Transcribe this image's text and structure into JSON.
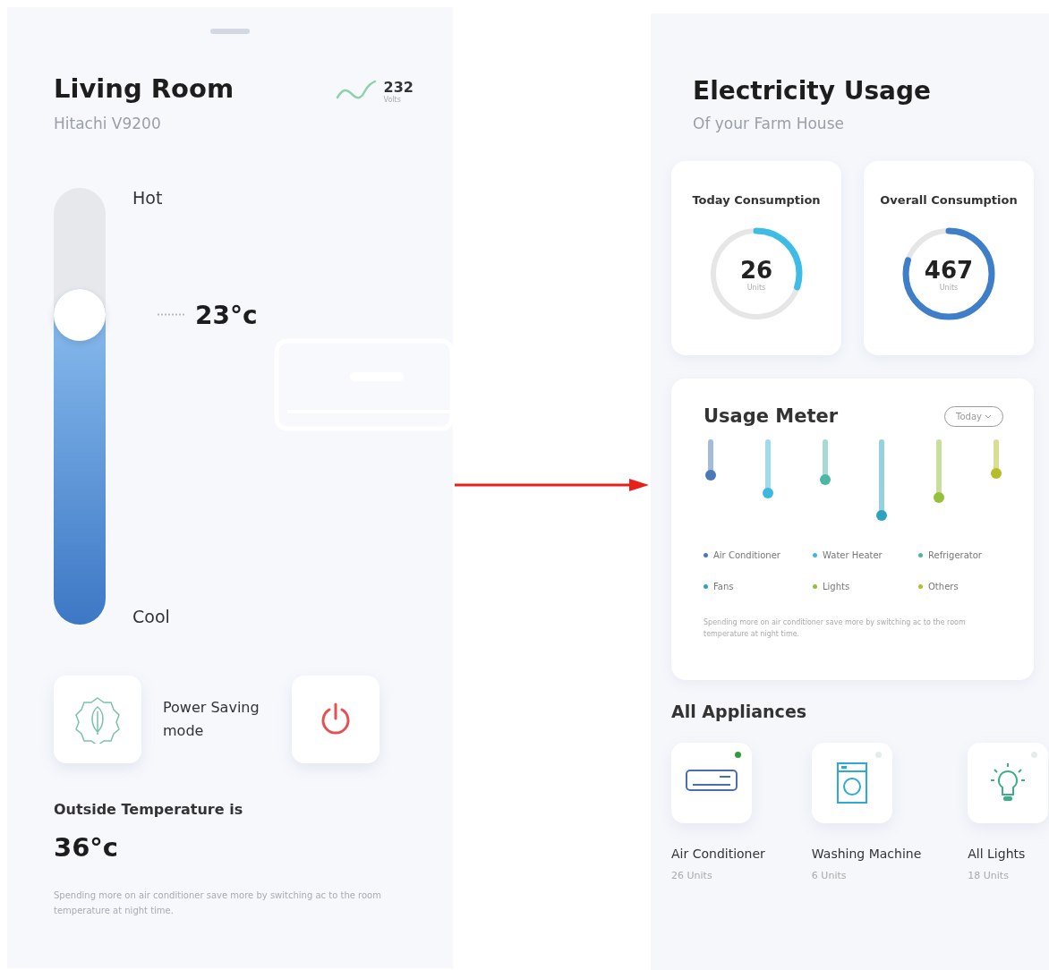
{
  "room": {
    "title": "Living Room",
    "subtitle": "Hitachi V9200",
    "voltage": "232",
    "voltage_unit": "Volts"
  },
  "thermostat": {
    "hot_label": "Hot",
    "cool_label": "Cool",
    "reading": "23°c"
  },
  "power_saving": {
    "label": "Power Saving mode"
  },
  "outside": {
    "label": "Outside Temperature is",
    "value": "36°c",
    "tip": "Spending more on air conditioner save more by switching ac to the room temperature at night time."
  },
  "usage": {
    "title": "Electricity Usage",
    "subtitle": "Of your Farm House",
    "consumption": [
      {
        "label": "Today Consumption",
        "value": "26",
        "unit": "Units",
        "color": "#3dbde6"
      },
      {
        "label": "Overall Consumption",
        "value": "467",
        "unit": "Units",
        "color": "#3f7fc9"
      }
    ]
  },
  "meter": {
    "title": "Usage Meter",
    "period": "Today",
    "items": [
      {
        "name": "Air Conditioner",
        "color": "#4a79b8"
      },
      {
        "name": "Water Heater",
        "color": "#3fb8e0"
      },
      {
        "name": "Refrigerator",
        "color": "#4db6a6"
      },
      {
        "name": "Fans",
        "color": "#2fa3bd"
      },
      {
        "name": "Lights",
        "color": "#95c03a"
      },
      {
        "name": "Others",
        "color": "#b5bd2a"
      }
    ],
    "tip": "Spending more on air conditioner save more by switching ac to the room temperature at night time."
  },
  "appliances": {
    "title": "All Appliances",
    "items": [
      {
        "kind": "ac",
        "name": "Air Conditioner",
        "units": "26 Units",
        "on": true
      },
      {
        "kind": "washer",
        "name": "Washing Machine",
        "units": "6 Units",
        "on": false
      },
      {
        "kind": "bulb",
        "name": "All Lights",
        "units": "18 Units",
        "on": false
      }
    ]
  }
}
